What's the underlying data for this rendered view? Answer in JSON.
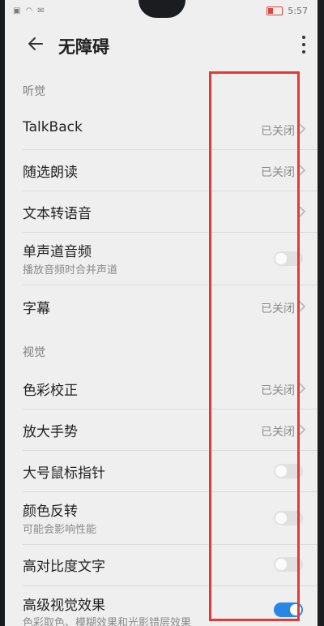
{
  "status_bar": {
    "left_icons": [
      "sim-icon",
      "wifi-icon",
      "notification-icon"
    ],
    "time": "5:57"
  },
  "app_bar": {
    "title": "无障碍"
  },
  "sections": {
    "hearing": "听觉",
    "vision": "视觉"
  },
  "items": {
    "talkback": {
      "title": "TalkBack",
      "value": "已关闭"
    },
    "select_to_speak": {
      "title": "随选朗读",
      "value": "已关闭"
    },
    "tts": {
      "title": "文本转语音"
    },
    "mono_audio": {
      "title": "单声道音频",
      "subtitle": "播放音频时合并声道",
      "enabled": false
    },
    "captions": {
      "title": "字幕",
      "value": "已关闭"
    },
    "color_correction": {
      "title": "色彩校正",
      "value": "已关闭"
    },
    "magnify": {
      "title": "放大手势",
      "value": "已关闭"
    },
    "large_pointer": {
      "title": "大号鼠标指针",
      "enabled": false
    },
    "color_inversion": {
      "title": "颜色反转",
      "subtitle": "可能会影响性能",
      "enabled": false
    },
    "high_contrast": {
      "title": "高对比度文字",
      "enabled": false
    },
    "advanced_visual": {
      "title": "高级视觉效果",
      "subtitle": "色彩取色、模糊效果和光影错层效果",
      "enabled": true
    }
  },
  "colors": {
    "accent": "#2a86e5",
    "highlight_border": "#e53935"
  }
}
